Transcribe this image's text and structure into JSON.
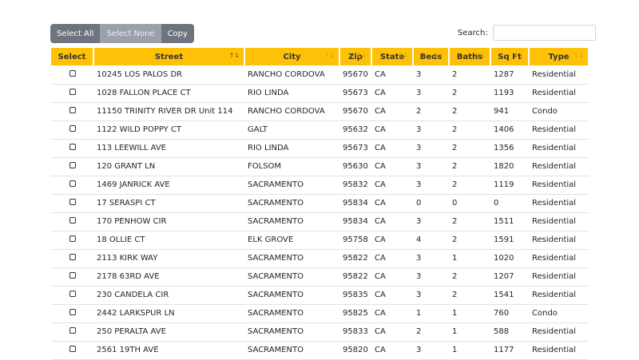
{
  "toolbar": {
    "select_all": "Select All",
    "select_none": "Select None",
    "copy": "Copy"
  },
  "search": {
    "label": "Search:",
    "value": ""
  },
  "columns": [
    "Select",
    "Street",
    "City",
    "Zip",
    "State",
    "Beds",
    "Baths",
    "Sq Ft",
    "Type"
  ],
  "rows": [
    [
      "10245 LOS PALOS DR",
      "RANCHO CORDOVA",
      "95670",
      "CA",
      "3",
      "2",
      "1287",
      "Residential"
    ],
    [
      "1028 FALLON PLACE CT",
      "RIO LINDA",
      "95673",
      "CA",
      "3",
      "2",
      "1193",
      "Residential"
    ],
    [
      "11150 TRINITY RIVER DR Unit 114",
      "RANCHO CORDOVA",
      "95670",
      "CA",
      "2",
      "2",
      "941",
      "Condo"
    ],
    [
      "1122 WILD POPPY CT",
      "GALT",
      "95632",
      "CA",
      "3",
      "2",
      "1406",
      "Residential"
    ],
    [
      "113 LEEWILL AVE",
      "RIO LINDA",
      "95673",
      "CA",
      "3",
      "2",
      "1356",
      "Residential"
    ],
    [
      "120 GRANT LN",
      "FOLSOM",
      "95630",
      "CA",
      "3",
      "2",
      "1820",
      "Residential"
    ],
    [
      "1469 JANRICK AVE",
      "SACRAMENTO",
      "95832",
      "CA",
      "3",
      "2",
      "1119",
      "Residential"
    ],
    [
      "17 SERASPI CT",
      "SACRAMENTO",
      "95834",
      "CA",
      "0",
      "0",
      "0",
      "Residential"
    ],
    [
      "170 PENHOW CIR",
      "SACRAMENTO",
      "95834",
      "CA",
      "3",
      "2",
      "1511",
      "Residential"
    ],
    [
      "18 OLLIE CT",
      "ELK GROVE",
      "95758",
      "CA",
      "4",
      "2",
      "1591",
      "Residential"
    ],
    [
      "2113 KIRK WAY",
      "SACRAMENTO",
      "95822",
      "CA",
      "3",
      "1",
      "1020",
      "Residential"
    ],
    [
      "2178 63RD AVE",
      "SACRAMENTO",
      "95822",
      "CA",
      "3",
      "2",
      "1207",
      "Residential"
    ],
    [
      "230 CANDELA CIR",
      "SACRAMENTO",
      "95835",
      "CA",
      "3",
      "2",
      "1541",
      "Residential"
    ],
    [
      "2442 LARKSPUR LN",
      "SACRAMENTO",
      "95825",
      "CA",
      "1",
      "1",
      "760",
      "Condo"
    ],
    [
      "250 PERALTA AVE",
      "SACRAMENTO",
      "95833",
      "CA",
      "2",
      "1",
      "588",
      "Residential"
    ],
    [
      "2561 19TH AVE",
      "SACRAMENTO",
      "95820",
      "CA",
      "3",
      "1",
      "1177",
      "Residential"
    ]
  ]
}
